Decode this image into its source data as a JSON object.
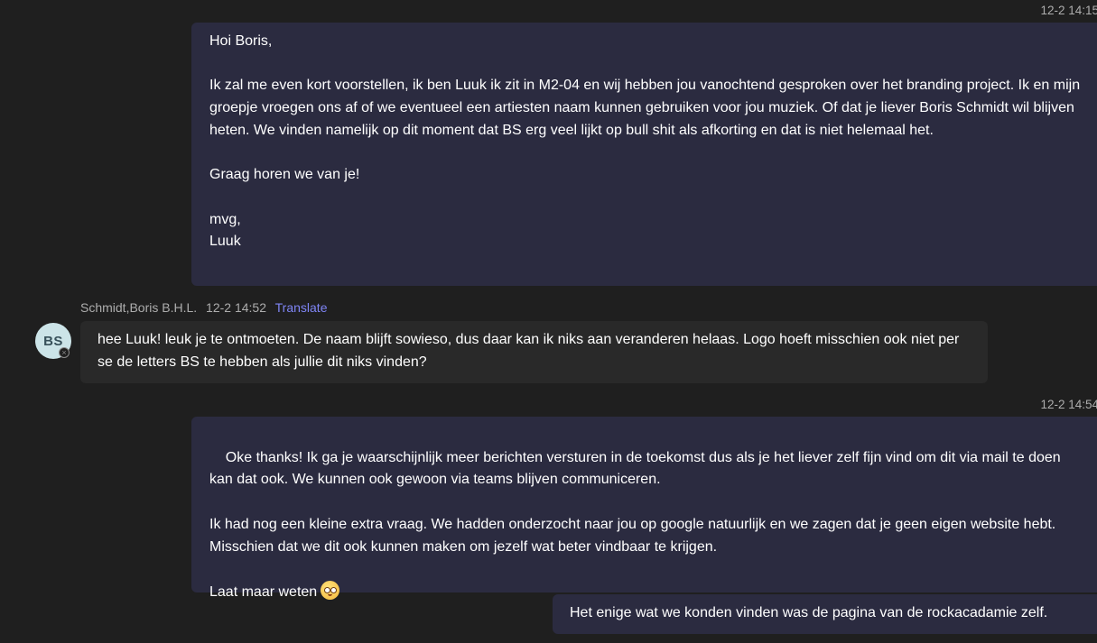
{
  "messages": [
    {
      "timestamp": "12-2 14:15",
      "text": "Hoi Boris,\n\nIk zal me even kort voorstellen, ik ben Luuk ik zit in M2-04 en wij hebben jou vanochtend gesproken over het branding project. Ik en mijn groepje vroegen ons af of we eventueel een artiesten naam kunnen gebruiken voor jou muziek. Of dat je liever Boris Schmidt wil blijven heten. We vinden namelijk op dit moment dat BS erg veel lijkt op bull shit als afkorting en dat is niet helemaal het.\n\nGraag horen we van je!\n\nmvg,\nLuuk"
    },
    {
      "sender": "Schmidt,Boris B.H.L.",
      "timestamp": "12-2 14:52",
      "translate_label": "Translate",
      "avatar_initials": "BS",
      "text": "hee Luuk! leuk je te ontmoeten. De naam blijft sowieso, dus daar kan ik niks aan veranderen helaas. Logo hoeft misschien ook niet per se de letters BS te hebben als jullie dit niks vinden?"
    },
    {
      "timestamp": "12-2 14:54",
      "text": "Oke thanks! Ik ga je waarschijnlijk meer berichten versturen in de toekomst dus als je het liever zelf fijn vind om dit via mail te doen kan dat ook. We kunnen ook gewoon via teams blijven communiceren.\n\nIk had nog een kleine extra vraag. We hadden onderzocht naar jou op google natuurlijk en we zagen dat je geen eigen website hebt. Misschien dat we dit ook kunnen maken om jezelf wat beter vindbaar te krijgen.\n\nLaat maar weten",
      "emoji": "smiling-face-icon"
    },
    {
      "text": "Het enige wat we konden vinden was de pagina van de rockacadamie zelf."
    }
  ],
  "colors": {
    "background": "#1f1f1f",
    "own_bubble": "#2b2b40",
    "other_bubble": "#292929",
    "meta_text": "#adadad",
    "link": "#7f85f5"
  }
}
